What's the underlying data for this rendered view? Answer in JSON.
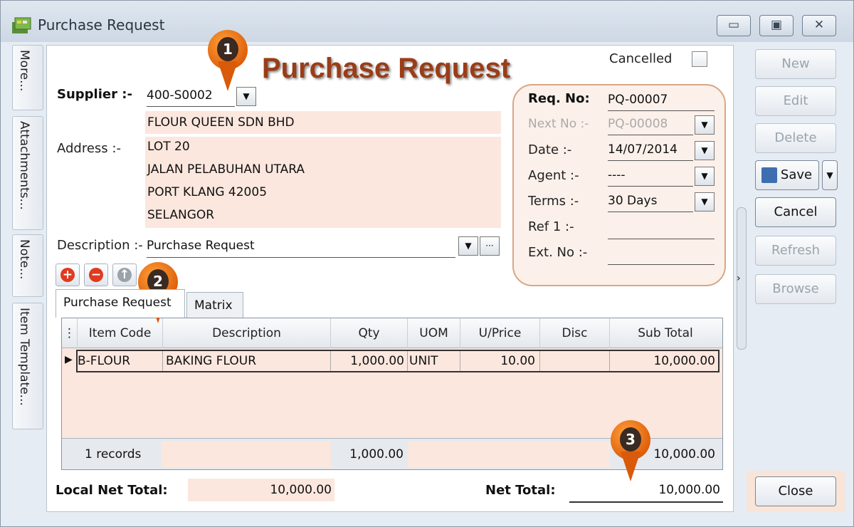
{
  "window": {
    "title": "Purchase Request",
    "min_icon": "minimize-icon",
    "max_icon": "maximize-icon",
    "close_icon": "close-icon"
  },
  "side_tabs": [
    "More...",
    "Attachments...",
    "Note...",
    "Item Template..."
  ],
  "form": {
    "heading": "Purchase Request",
    "cancelled_label": "Cancelled",
    "supplier_label": "Supplier :-",
    "supplier_code": "400-S0002",
    "supplier_name": "FLOUR QUEEN SDN BHD",
    "address_label": "Address :-",
    "address": [
      "LOT 20",
      "JALAN PELABUHAN UTARA",
      "PORT KLANG 42005",
      "SELANGOR"
    ],
    "description_label": "Description :-",
    "description": "Purchase Request"
  },
  "req": {
    "req_no_label": "Req. No:",
    "req_no": "PQ-00007",
    "next_no_label": "Next No :-",
    "next_no": "PQ-00008",
    "date_label": "Date :-",
    "date": "14/07/2014",
    "agent_label": "Agent :-",
    "agent": "----",
    "terms_label": "Terms :-",
    "terms": "30 Days",
    "ref1_label": "Ref 1 :-",
    "ref1": "",
    "extno_label": "Ext. No :-",
    "extno": ""
  },
  "tabs": [
    "Purchase Request",
    "Matrix"
  ],
  "grid": {
    "columns": [
      "Item Code",
      "Description",
      "Qty",
      "UOM",
      "U/Price",
      "Disc",
      "Sub Total"
    ],
    "rows": [
      {
        "item_code": "B-FLOUR",
        "description": "BAKING FLOUR",
        "qty": "1,000.00",
        "uom": "UNIT",
        "uprice": "10.00",
        "disc": "",
        "subtotal": "10,000.00"
      }
    ],
    "footer": {
      "records": "1 records",
      "qty_total": "1,000.00",
      "subtotal_total": "10,000.00"
    }
  },
  "totals": {
    "local_label": "Local Net Total:",
    "local_value": "10,000.00",
    "net_label": "Net Total:",
    "net_value": "10,000.00"
  },
  "buttons": {
    "new": "New",
    "edit": "Edit",
    "delete": "Delete",
    "save": "Save",
    "cancel": "Cancel",
    "refresh": "Refresh",
    "browse": "Browse",
    "close": "Close"
  },
  "callouts": [
    "1",
    "2",
    "3"
  ],
  "colors": {
    "accent_orange": "#e0600c",
    "peach": "#fbe7de",
    "heading": "#9a3d18"
  }
}
